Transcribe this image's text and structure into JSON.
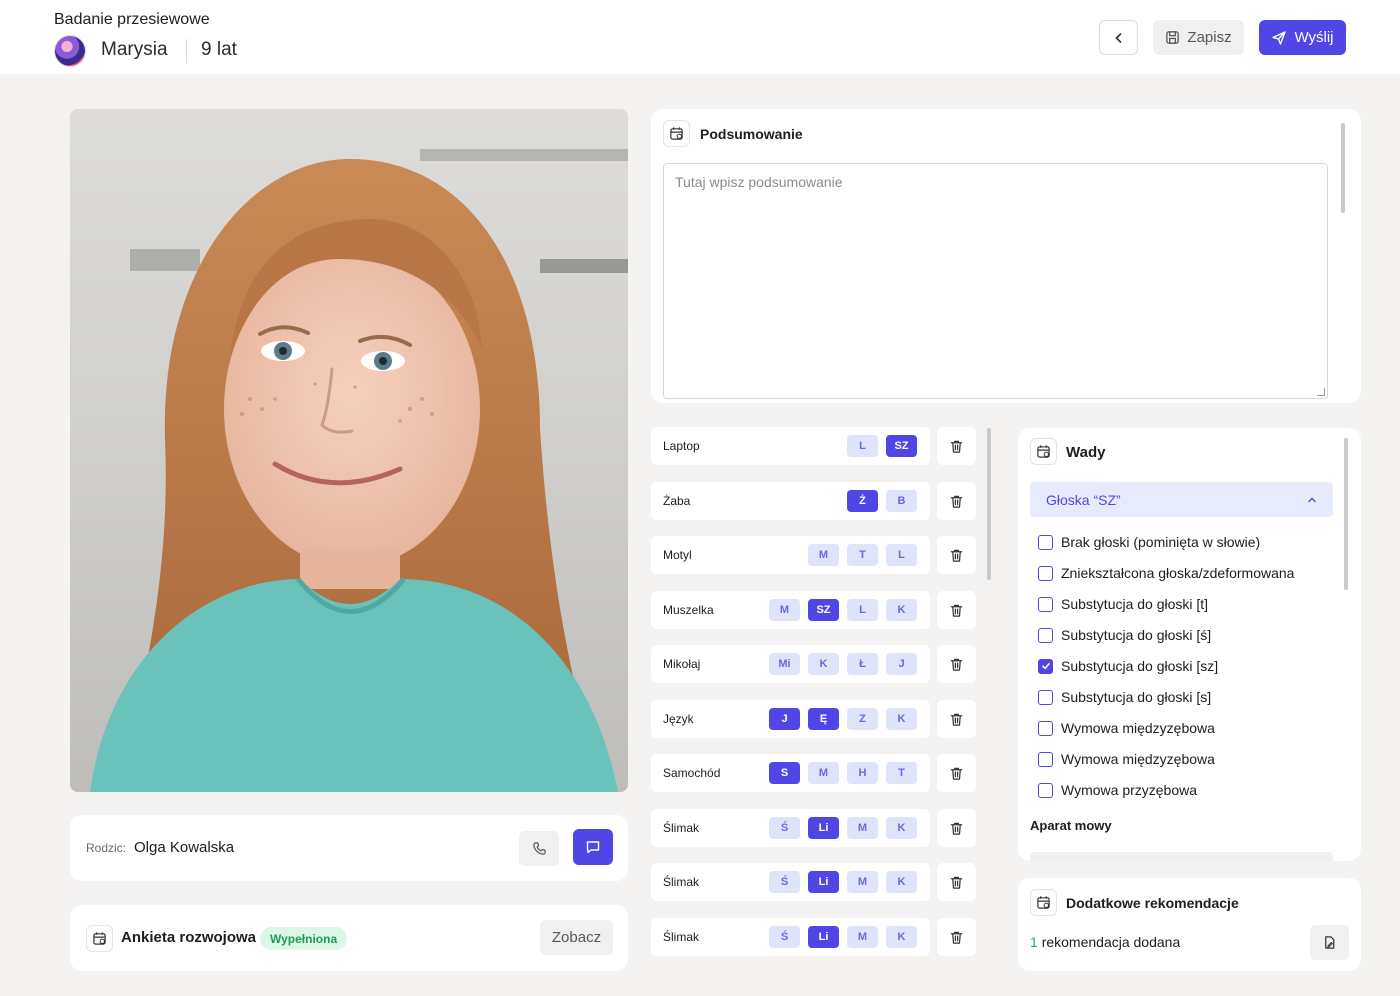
{
  "header": {
    "title": "Badanie przesiewowe",
    "child_name": "Marysia",
    "child_age": "9 lat",
    "save_label": "Zapisz",
    "send_label": "Wyślij",
    "accent_color": "#4f46e5"
  },
  "parent": {
    "label": "Rodzic:",
    "name": "Olga Kowalska"
  },
  "survey": {
    "title": "Ankieta rozwojowa",
    "status": "Wypełniona",
    "see_label": "Zobacz"
  },
  "summary": {
    "title": "Podsumowanie",
    "placeholder": "Tutaj wpisz podsumowanie"
  },
  "words": [
    {
      "word": "Laptop",
      "phonemes": [
        {
          "t": "L",
          "on": false
        },
        {
          "t": "SZ",
          "on": true
        }
      ]
    },
    {
      "word": "Żaba",
      "phonemes": [
        {
          "t": "Ż",
          "on": true
        },
        {
          "t": "B",
          "on": false
        }
      ]
    },
    {
      "word": "Motyl",
      "phonemes": [
        {
          "t": "M",
          "on": false
        },
        {
          "t": "T",
          "on": false
        },
        {
          "t": "L",
          "on": false
        }
      ]
    },
    {
      "word": "Muszelka",
      "phonemes": [
        {
          "t": "M",
          "on": false
        },
        {
          "t": "SZ",
          "on": true
        },
        {
          "t": "L",
          "on": false
        },
        {
          "t": "K",
          "on": false
        }
      ]
    },
    {
      "word": "Mikołaj",
      "phonemes": [
        {
          "t": "Mi",
          "on": false
        },
        {
          "t": "K",
          "on": false
        },
        {
          "t": "Ł",
          "on": false
        },
        {
          "t": "J",
          "on": false
        }
      ]
    },
    {
      "word": "Język",
      "phonemes": [
        {
          "t": "J",
          "on": true
        },
        {
          "t": "Ę",
          "on": true
        },
        {
          "t": "Z",
          "on": false
        },
        {
          "t": "K",
          "on": false
        }
      ]
    },
    {
      "word": "Samochód",
      "phonemes": [
        {
          "t": "S",
          "on": true
        },
        {
          "t": "M",
          "on": false
        },
        {
          "t": "H",
          "on": false
        },
        {
          "t": "T",
          "on": false
        }
      ]
    },
    {
      "word": "Ślimak",
      "phonemes": [
        {
          "t": "Ś",
          "on": false
        },
        {
          "t": "Li",
          "on": true
        },
        {
          "t": "M",
          "on": false
        },
        {
          "t": "K",
          "on": false
        }
      ]
    },
    {
      "word": "Ślimak",
      "phonemes": [
        {
          "t": "Ś",
          "on": false
        },
        {
          "t": "Li",
          "on": true
        },
        {
          "t": "M",
          "on": false
        },
        {
          "t": "K",
          "on": false
        }
      ]
    },
    {
      "word": "Ślimak",
      "phonemes": [
        {
          "t": "Ś",
          "on": false
        },
        {
          "t": "Li",
          "on": true
        },
        {
          "t": "M",
          "on": false
        },
        {
          "t": "K",
          "on": false
        }
      ]
    }
  ],
  "defects": {
    "title": "Wady",
    "dropdown_label": "Głoska “SZ”",
    "options": [
      {
        "label": "Brak głoski (pominięta w słowie)",
        "checked": false
      },
      {
        "label": "Zniekształcona głoska/zdeformowana",
        "checked": false
      },
      {
        "label": "Substytucja do głoski [t]",
        "checked": false
      },
      {
        "label": "Substytucja do głoski [ś]",
        "checked": false
      },
      {
        "label": "Substytucja do głoski [sz]",
        "checked": true
      },
      {
        "label": "Substytucja do głoski [s]",
        "checked": false
      },
      {
        "label": "Wymowa międzyzębowa",
        "checked": false
      },
      {
        "label": "Wymowa międzyzębowa",
        "checked": false
      },
      {
        "label": "Wymowa przyzębowa",
        "checked": false
      }
    ],
    "section_label": "Aparat mowy"
  },
  "recommendations": {
    "title": "Dodatkowe rekomendacje",
    "count": "1",
    "count_text": "rekomendacja dodana"
  }
}
